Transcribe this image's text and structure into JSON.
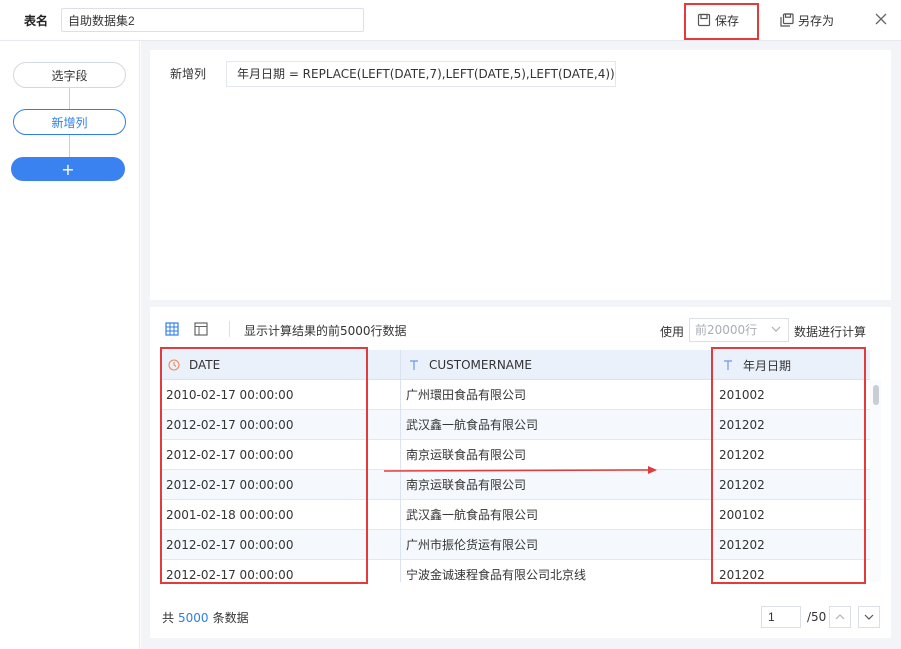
{
  "topbar": {
    "table_name_label": "表名",
    "table_name_value": "自助数据集2",
    "save_label": "保存",
    "save_as_label": "另存为",
    "icons": {
      "save": "save-icon",
      "save_as": "save-as-icon",
      "close": "close-icon"
    }
  },
  "steps": {
    "items": [
      {
        "label": "选字段",
        "active": false
      },
      {
        "label": "新增列",
        "active": true
      }
    ],
    "add_label": "+"
  },
  "formula": {
    "label": "新增列",
    "expression": "年月日期 = REPLACE(LEFT(DATE,7),LEFT(DATE,5),LEFT(DATE,4))"
  },
  "result": {
    "view_icons": [
      "grid-view-icon",
      "layout-view-icon"
    ],
    "description": "显示计算结果的前5000行数据",
    "use_label": "使用",
    "rows_select_value": "前20000行",
    "calc_label": "数据进行计算"
  },
  "table": {
    "columns": [
      {
        "name": "DATE",
        "type_icon": "clock-icon"
      },
      {
        "name": "CUSTOMERNAME",
        "type_icon": "text-type-icon"
      },
      {
        "name": "年月日期",
        "type_icon": "text-type-icon"
      }
    ],
    "rows": [
      [
        "2010-02-17 00:00:00",
        "广州環田食品有限公司",
        "201002"
      ],
      [
        "2012-02-17 00:00:00",
        "武汉鑫一航食品有限公司",
        "201202"
      ],
      [
        "2012-02-17 00:00:00",
        "南京运联食品有限公司",
        "201202"
      ],
      [
        "2012-02-17 00:00:00",
        "南京运联食品有限公司",
        "201202"
      ],
      [
        "2001-02-18 00:00:00",
        "武汉鑫一航食品有限公司",
        "200102"
      ],
      [
        "2012-02-17 00:00:00",
        "广州市振伦货运有限公司",
        "201202"
      ],
      [
        "2012-02-17 00:00:00",
        "宁波金诚速程食品有限公司北京线",
        "201202"
      ]
    ]
  },
  "footer": {
    "total_prefix": "共",
    "total_count": "5000",
    "total_suffix": "条数据",
    "page_current": "1",
    "page_total": "/50"
  },
  "colors": {
    "accent": "#2f7ee8",
    "annotation_red": "#e23b3b",
    "header_bg": "#eaf1fb",
    "date_icon": "#f08a5d"
  }
}
